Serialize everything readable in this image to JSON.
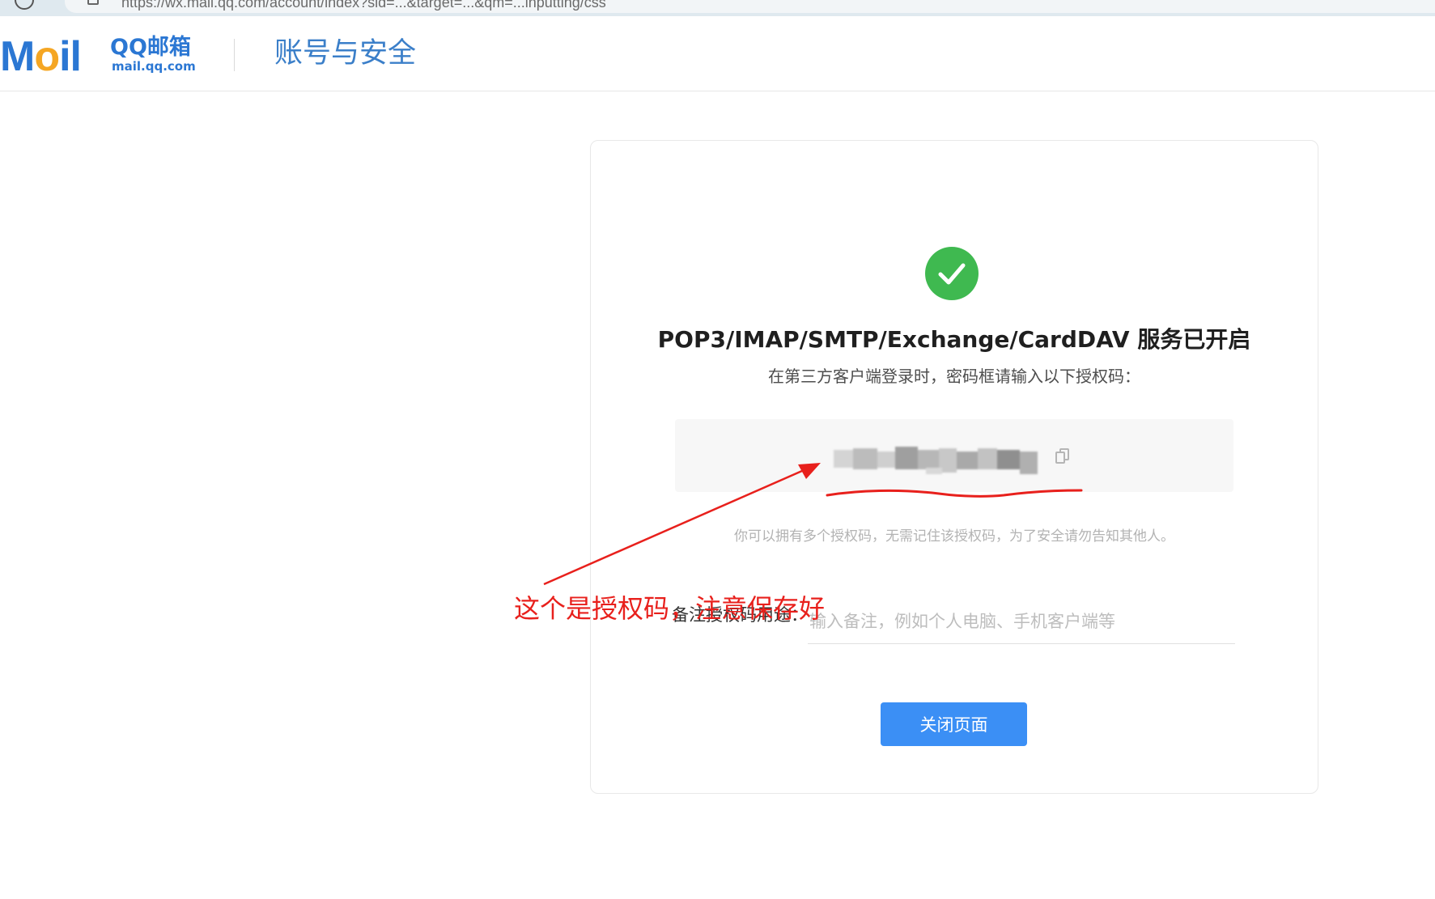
{
  "browser": {
    "url": "https://wx.mail.qq.com/account/index?sid=...&target=...&qm=...inputting/css"
  },
  "header": {
    "logo_text_m": "M",
    "logo_text_o": "o",
    "logo_text_il": "il",
    "logo_brand": "QQ邮箱",
    "logo_domain": "mail.qq.com",
    "page_title": "账号与安全"
  },
  "card": {
    "title": "POP3/IMAP/SMTP/Exchange/CardDAV 服务已开启",
    "subtitle": "在第三方客户端登录时，密码框请输入以下授权码：",
    "hint": "你可以拥有多个授权码，无需记住该授权码，为了安全请勿告知其他人。",
    "note_label": "备注授权码用途：",
    "note_placeholder": "输入备注，例如个人电脑、手机客户端等",
    "close_button": "关闭页面"
  },
  "annotation": {
    "text": "这个是授权码，注意保存好",
    "color": "#e8201c"
  },
  "colors": {
    "success": "#3fb950",
    "primary_button": "#3b8ff5",
    "brand_blue": "#2b77d3"
  },
  "icons": {
    "success": "check-circle-icon",
    "copy": "copy-icon"
  }
}
